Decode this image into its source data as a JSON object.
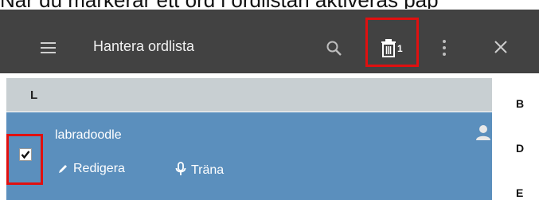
{
  "caption": "När du markerar ett ord i ordlistan aktiveras pap",
  "toolbar": {
    "title": "Hantera ordlista",
    "delete_count": "1"
  },
  "list": {
    "section_letter": "L",
    "entry": {
      "word": "labradoodle",
      "checked": true,
      "edit_label": "Redigera",
      "train_label": "Träna"
    }
  },
  "index": [
    "B",
    "D",
    "E"
  ],
  "colors": {
    "toolbar_bg": "#424242",
    "section_header_bg": "#c8cfd2",
    "selected_row_bg": "#5b8fbd",
    "highlight_border": "#e01010"
  }
}
